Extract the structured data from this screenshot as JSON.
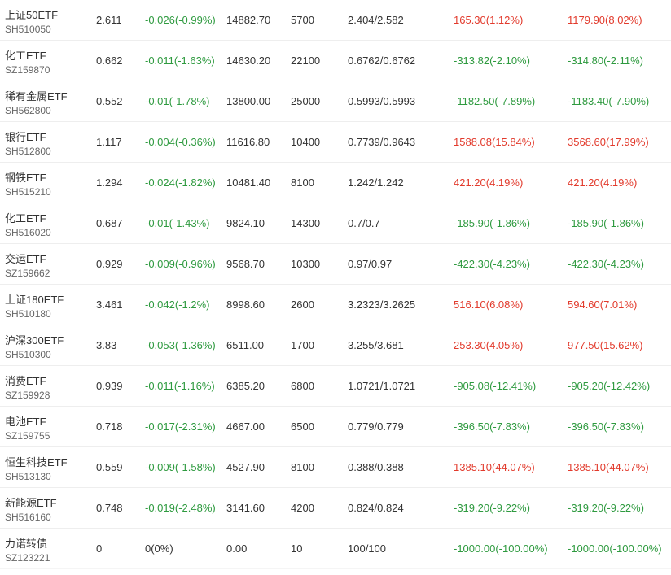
{
  "colors": {
    "up": "#e23a2c",
    "down": "#2e9a3f",
    "flat": "#333333"
  },
  "holdings": [
    {
      "name": "上证50ETF",
      "code": "SH510050",
      "price": "2.611",
      "change": "-0.026(-0.99%)",
      "change_dir": "down",
      "market_value": "14882.70",
      "quantity": "5700",
      "cost_price": "2.404/2.582",
      "pl1": "165.30(1.12%)",
      "pl1_dir": "up",
      "pl2": "1179.90(8.02%)",
      "pl2_dir": "up"
    },
    {
      "name": "化工ETF",
      "code": "SZ159870",
      "price": "0.662",
      "change": "-0.011(-1.63%)",
      "change_dir": "down",
      "market_value": "14630.20",
      "quantity": "22100",
      "cost_price": "0.6762/0.6762",
      "pl1": "-313.82(-2.10%)",
      "pl1_dir": "down",
      "pl2": "-314.80(-2.11%)",
      "pl2_dir": "down"
    },
    {
      "name": "稀有金属ETF",
      "code": "SH562800",
      "price": "0.552",
      "change": "-0.01(-1.78%)",
      "change_dir": "down",
      "market_value": "13800.00",
      "quantity": "25000",
      "cost_price": "0.5993/0.5993",
      "pl1": "-1182.50(-7.89%)",
      "pl1_dir": "down",
      "pl2": "-1183.40(-7.90%)",
      "pl2_dir": "down"
    },
    {
      "name": "银行ETF",
      "code": "SH512800",
      "price": "1.117",
      "change": "-0.004(-0.36%)",
      "change_dir": "down",
      "market_value": "11616.80",
      "quantity": "10400",
      "cost_price": "0.7739/0.9643",
      "pl1": "1588.08(15.84%)",
      "pl1_dir": "up",
      "pl2": "3568.60(17.99%)",
      "pl2_dir": "up"
    },
    {
      "name": "钢铁ETF",
      "code": "SH515210",
      "price": "1.294",
      "change": "-0.024(-1.82%)",
      "change_dir": "down",
      "market_value": "10481.40",
      "quantity": "8100",
      "cost_price": "1.242/1.242",
      "pl1": "421.20(4.19%)",
      "pl1_dir": "up",
      "pl2": "421.20(4.19%)",
      "pl2_dir": "up"
    },
    {
      "name": "化工ETF",
      "code": "SH516020",
      "price": "0.687",
      "change": "-0.01(-1.43%)",
      "change_dir": "down",
      "market_value": "9824.10",
      "quantity": "14300",
      "cost_price": "0.7/0.7",
      "pl1": "-185.90(-1.86%)",
      "pl1_dir": "down",
      "pl2": "-185.90(-1.86%)",
      "pl2_dir": "down"
    },
    {
      "name": "交运ETF",
      "code": "SZ159662",
      "price": "0.929",
      "change": "-0.009(-0.96%)",
      "change_dir": "down",
      "market_value": "9568.70",
      "quantity": "10300",
      "cost_price": "0.97/0.97",
      "pl1": "-422.30(-4.23%)",
      "pl1_dir": "down",
      "pl2": "-422.30(-4.23%)",
      "pl2_dir": "down"
    },
    {
      "name": "上证180ETF",
      "code": "SH510180",
      "price": "3.461",
      "change": "-0.042(-1.2%)",
      "change_dir": "down",
      "market_value": "8998.60",
      "quantity": "2600",
      "cost_price": "3.2323/3.2625",
      "pl1": "516.10(6.08%)",
      "pl1_dir": "up",
      "pl2": "594.60(7.01%)",
      "pl2_dir": "up"
    },
    {
      "name": "沪深300ETF",
      "code": "SH510300",
      "price": "3.83",
      "change": "-0.053(-1.36%)",
      "change_dir": "down",
      "market_value": "6511.00",
      "quantity": "1700",
      "cost_price": "3.255/3.681",
      "pl1": "253.30(4.05%)",
      "pl1_dir": "up",
      "pl2": "977.50(15.62%)",
      "pl2_dir": "up"
    },
    {
      "name": "消费ETF",
      "code": "SZ159928",
      "price": "0.939",
      "change": "-0.011(-1.16%)",
      "change_dir": "down",
      "market_value": "6385.20",
      "quantity": "6800",
      "cost_price": "1.0721/1.0721",
      "pl1": "-905.08(-12.41%)",
      "pl1_dir": "down",
      "pl2": "-905.20(-12.42%)",
      "pl2_dir": "down"
    },
    {
      "name": "电池ETF",
      "code": "SZ159755",
      "price": "0.718",
      "change": "-0.017(-2.31%)",
      "change_dir": "down",
      "market_value": "4667.00",
      "quantity": "6500",
      "cost_price": "0.779/0.779",
      "pl1": "-396.50(-7.83%)",
      "pl1_dir": "down",
      "pl2": "-396.50(-7.83%)",
      "pl2_dir": "down"
    },
    {
      "name": "恒生科技ETF",
      "code": "SH513130",
      "price": "0.559",
      "change": "-0.009(-1.58%)",
      "change_dir": "down",
      "market_value": "4527.90",
      "quantity": "8100",
      "cost_price": "0.388/0.388",
      "pl1": "1385.10(44.07%)",
      "pl1_dir": "up",
      "pl2": "1385.10(44.07%)",
      "pl2_dir": "up"
    },
    {
      "name": "新能源ETF",
      "code": "SH516160",
      "price": "0.748",
      "change": "-0.019(-2.48%)",
      "change_dir": "down",
      "market_value": "3141.60",
      "quantity": "4200",
      "cost_price": "0.824/0.824",
      "pl1": "-319.20(-9.22%)",
      "pl1_dir": "down",
      "pl2": "-319.20(-9.22%)",
      "pl2_dir": "down"
    },
    {
      "name": "力诺转债",
      "code": "SZ123221",
      "price": "0",
      "change": "0(0%)",
      "change_dir": "flat",
      "market_value": "0.00",
      "quantity": "10",
      "cost_price": "100/100",
      "pl1": "-1000.00(-100.00%)",
      "pl1_dir": "down",
      "pl2": "-1000.00(-100.00%)",
      "pl2_dir": "down"
    }
  ]
}
